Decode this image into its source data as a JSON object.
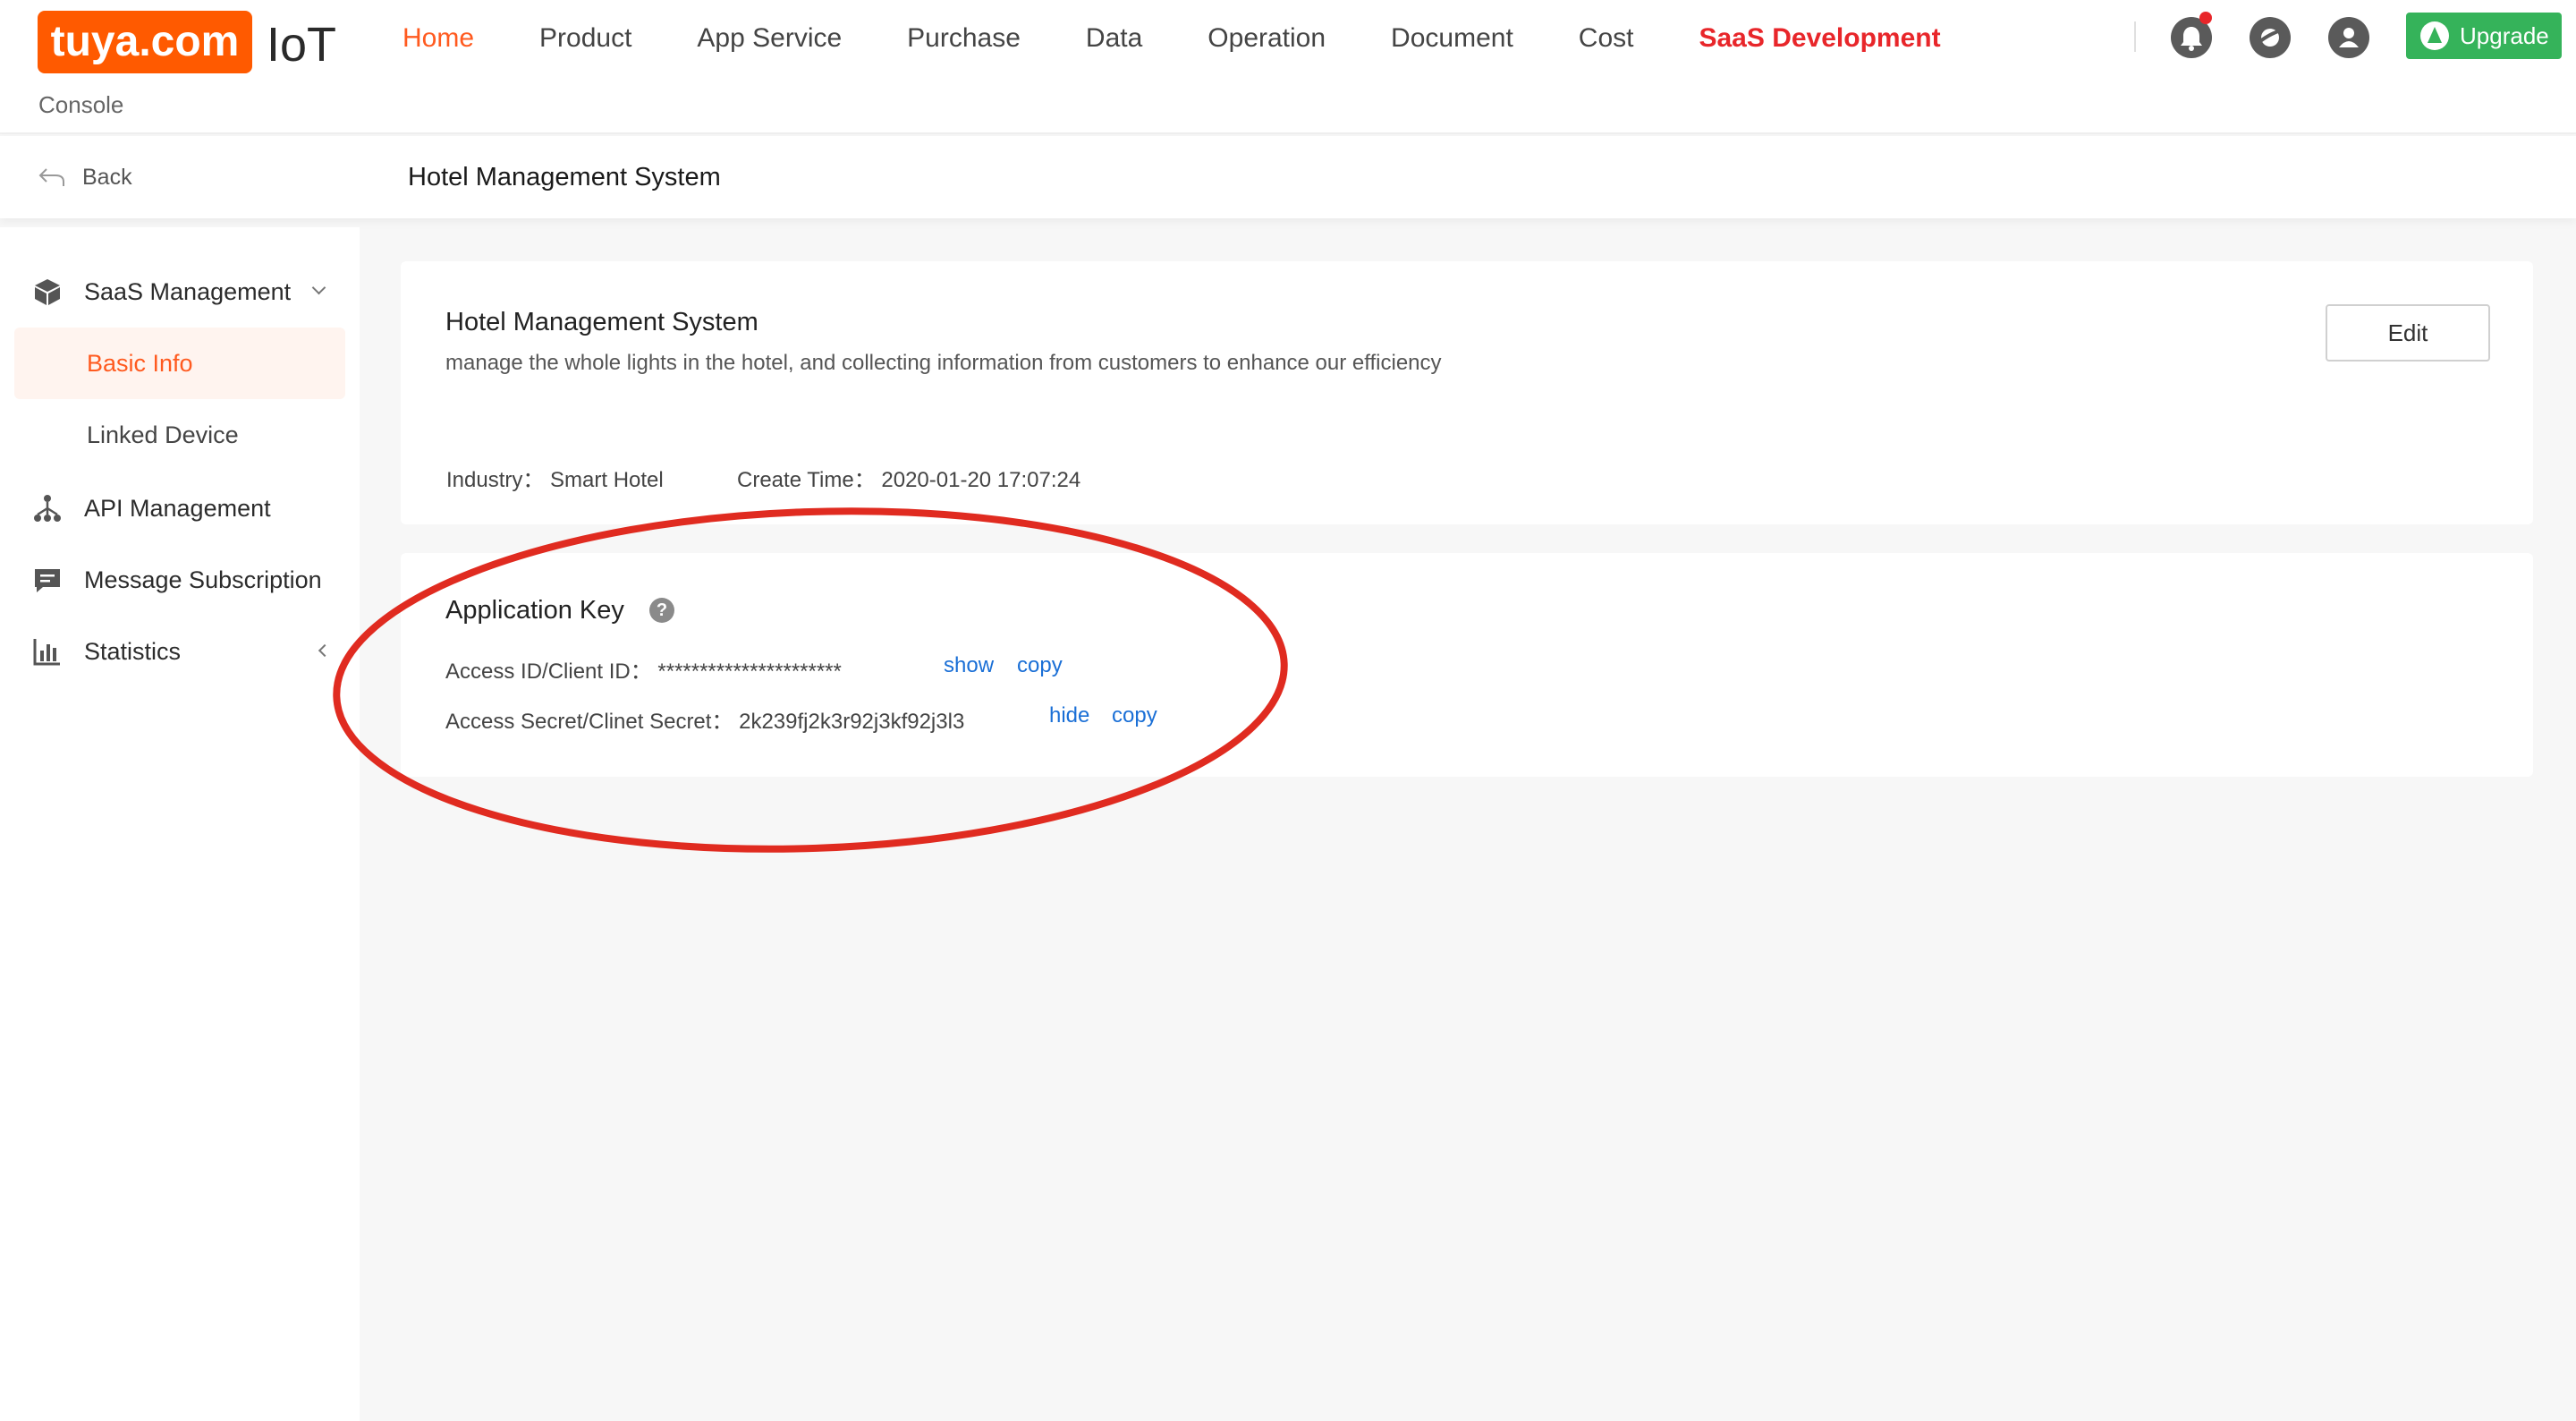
{
  "brand": {
    "logo_text": "tuya.com",
    "product": "IoT",
    "console_label": "Console",
    "accent_color": "#ff5a00"
  },
  "nav": {
    "items": [
      {
        "label": "Home",
        "state": "active"
      },
      {
        "label": "Product",
        "state": "normal"
      },
      {
        "label": "App Service",
        "state": "normal"
      },
      {
        "label": "Purchase",
        "state": "normal"
      },
      {
        "label": "Data",
        "state": "normal"
      },
      {
        "label": "Operation",
        "state": "normal"
      },
      {
        "label": "Document",
        "state": "normal"
      },
      {
        "label": "Cost",
        "state": "normal"
      },
      {
        "label": "SaaS Development",
        "state": "highlight"
      }
    ],
    "icons": [
      "bell-icon",
      "planet-icon",
      "user-icon"
    ],
    "upgrade_label": "Upgrade"
  },
  "subheader": {
    "back_label": "Back",
    "title": "Hotel Management System"
  },
  "sidebar": {
    "items": [
      {
        "label": "SaaS Management",
        "icon": "box-icon",
        "expanded": true
      },
      {
        "label": "Basic Info",
        "active": true
      },
      {
        "label": "Linked Device"
      },
      {
        "label": "API Management",
        "icon": "hierarchy-icon"
      },
      {
        "label": "Message Subscription",
        "icon": "message-icon"
      },
      {
        "label": "Statistics",
        "icon": "bar-chart-icon"
      }
    ]
  },
  "basic_card": {
    "title": "Hotel Management System",
    "description": "manage the whole lights in the hotel, and collecting information from customers to enhance our efficiency",
    "industry": "Industry： Smart Hotel",
    "create_time": "Create Time： 2020-01-20 17:07:24",
    "edit_label": "Edit"
  },
  "key_card": {
    "title": "Application Key",
    "help_glyph": "?",
    "access_id": "Access ID/Client ID： **********************",
    "access_id_show": "show",
    "access_id_copy": "copy",
    "access_secret": "Access Secret/Clinet Secret： 2k239fj2k3r92j3kf92j3l3",
    "access_secret_hide": "hide",
    "access_secret_copy": "copy"
  },
  "annotation": {
    "color": "#e02b20"
  }
}
